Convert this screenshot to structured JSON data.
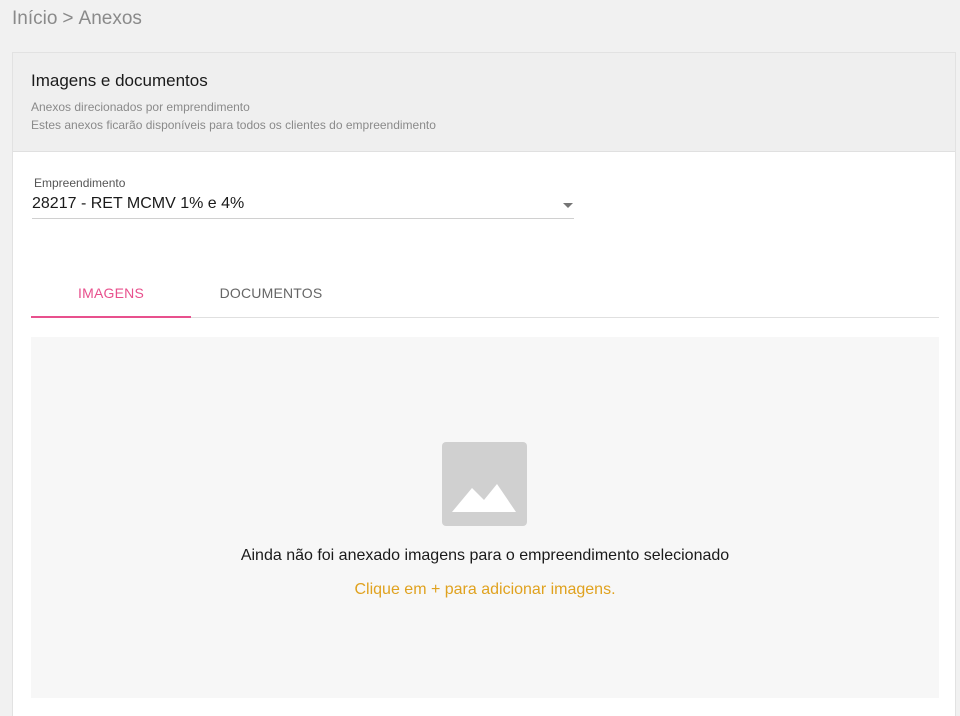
{
  "breadcrumb": {
    "home": "Início",
    "separator": ">",
    "current": "Anexos"
  },
  "header": {
    "title": "Imagens e documentos",
    "subtitle1": "Anexos direcionados por emprendimento",
    "subtitle2": "Estes anexos ficarão disponíveis para todos os clientes do empreendimento"
  },
  "select": {
    "label": "Empreendimento",
    "value": "28217 - RET MCMV 1% e 4%"
  },
  "tabs": [
    {
      "label": "IMAGENS",
      "active": true
    },
    {
      "label": "DOCUMENTOS",
      "active": false
    }
  ],
  "empty": {
    "icon": "image-placeholder-icon",
    "message": "Ainda não foi anexado imagens para o empreendimento selecionado",
    "hint": "Clique em + para adicionar imagens."
  },
  "colors": {
    "accent": "#e8508d",
    "hint": "#e0a21f",
    "icon_bg": "#d0d0d0"
  }
}
